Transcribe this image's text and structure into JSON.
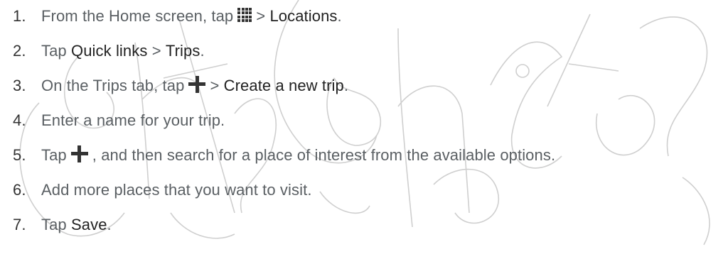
{
  "steps": [
    {
      "num": "1.",
      "parts": [
        "From the Home screen, tap",
        ">",
        "Locations",
        "."
      ]
    },
    {
      "num": "2.",
      "parts": [
        "Tap",
        "Quick links",
        ">",
        "Trips",
        "."
      ]
    },
    {
      "num": "3.",
      "parts": [
        "On the Trips tab, tap",
        ">",
        "Create a new trip",
        "."
      ]
    },
    {
      "num": "4.",
      "parts": [
        "Enter a name for your trip."
      ]
    },
    {
      "num": "5.",
      "parts": [
        "Tap",
        ", and then search for a place of interest from the available options."
      ]
    },
    {
      "num": "6.",
      "parts": [
        "Add more places that you want to visit."
      ]
    },
    {
      "num": "7.",
      "parts": [
        "Tap",
        "Save",
        "."
      ]
    }
  ],
  "icons": {
    "apps": "all-apps-grid-icon",
    "add": "plus-icon"
  },
  "colors": {
    "text": "#5a5f63",
    "emphasis": "#222222",
    "watermark": "#c8c8c8"
  }
}
